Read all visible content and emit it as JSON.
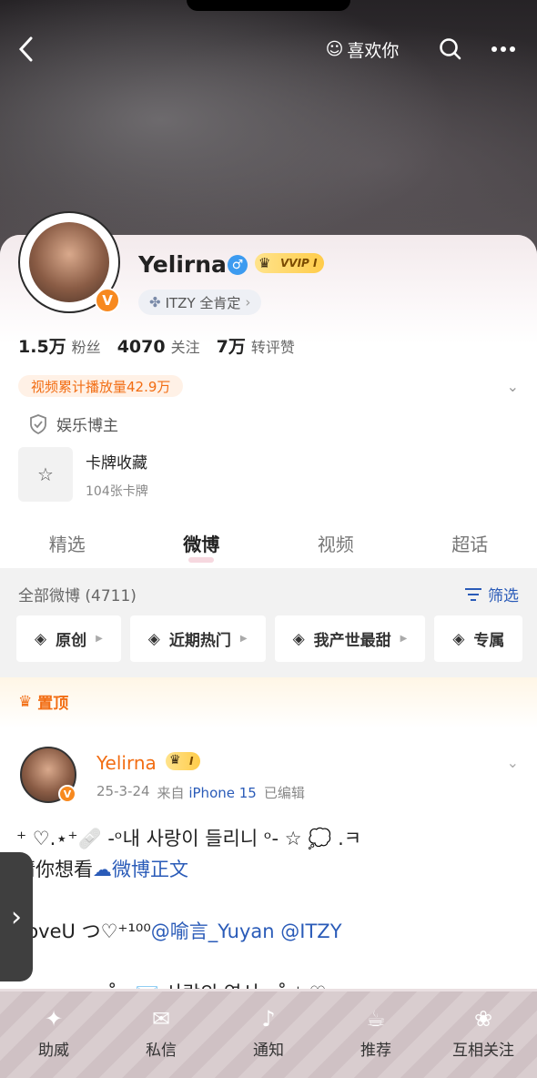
{
  "header": {
    "like_label": "喜欢你"
  },
  "profile": {
    "name": "Yelirna",
    "vip_label": "VVIP I",
    "fan_tag": "ITZY 全肯定",
    "stats": [
      {
        "value": "1.5万",
        "label": "粉丝"
      },
      {
        "value": "4070",
        "label": "关注"
      },
      {
        "value": "7万",
        "label": "转评赞"
      }
    ],
    "video_plays": "视频累计播放量42.9万",
    "identity": "娱乐博主",
    "card_title": "卡牌收藏",
    "card_sub": "104张卡牌"
  },
  "tabs": [
    "精选",
    "微博",
    "视频",
    "超话"
  ],
  "feed": {
    "all_posts": "全部微博 (4711)",
    "filter": "筛选",
    "chips": [
      "原创",
      "近期热门",
      "我产世最甜",
      "专属"
    ]
  },
  "post": {
    "pinned": "置顶",
    "author": "Yelirna",
    "vip_label": "I",
    "date": "25-3-24",
    "source_prefix": "来自",
    "source": "iPhone 15",
    "edited": "已编辑",
    "line1": "⁺ ♡.⋆⁺🩹 -ᵒ내 사랑이 들리니 ᵒ- ☆ 💭 .ㅋ",
    "line2_prefix": "请你想看",
    "line2_link": "微博正文",
    "line3_prefix": "LoveU つ♡⁺¹⁰⁰",
    "mention1": "@喻言_Yuyan",
    "mention2": "@ITZY",
    "line4": "˚ · 💌 사랑의 연서 · ˚ ⁺ ♡"
  },
  "bottom_nav": [
    "助威",
    "私信",
    "通知",
    "推荐",
    "互相关注"
  ]
}
